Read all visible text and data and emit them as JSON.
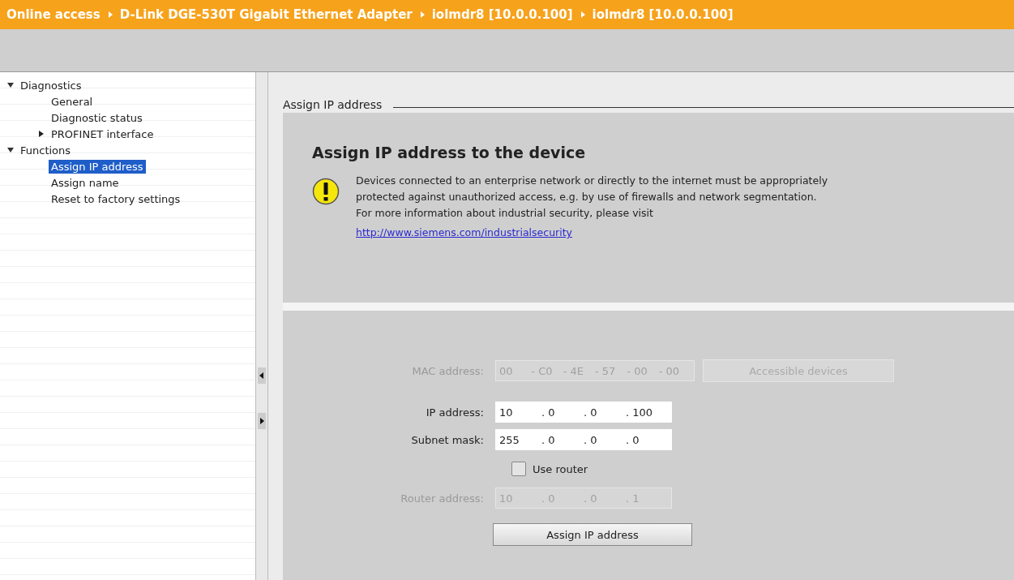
{
  "breadcrumb": [
    "Online access",
    "D-Link DGE-530T Gigabit Ethernet Adapter",
    "iolmdr8 [10.0.0.100]",
    "iolmdr8 [10.0.0.100]"
  ],
  "tree": [
    {
      "label": "Diagnostics",
      "expanded": true,
      "selected": false,
      "children": [
        {
          "label": "General",
          "selected": false
        },
        {
          "label": "Diagnostic status",
          "selected": false
        },
        {
          "label": "PROFINET interface",
          "expanded": false,
          "selected": false
        }
      ]
    },
    {
      "label": "Functions",
      "expanded": true,
      "selected": false,
      "children": [
        {
          "label": "Assign IP address",
          "selected": true
        },
        {
          "label": "Assign name",
          "selected": false
        },
        {
          "label": "Reset to factory settings",
          "selected": false
        }
      ]
    }
  ],
  "section_title": "Assign IP address",
  "notice": {
    "heading": "Assign IP address to the device",
    "lines": [
      "Devices connected to an enterprise network or directly to the internet must be appropriately",
      "protected against unauthorized access, e.g. by use of firewalls and network segmentation.",
      "For more information about industrial security, please visit"
    ],
    "link": "http://www.siemens.com/industrialsecurity"
  },
  "form": {
    "rows": [
      {
        "kind": "address",
        "label": "MAC address:",
        "disabled": true,
        "separator": "-",
        "parts": [
          "00",
          "C0",
          "4E",
          "57",
          "00",
          "00"
        ],
        "button": {
          "label": "Accessible devices",
          "disabled": true
        }
      },
      {
        "kind": "address",
        "label": "IP address:",
        "disabled": false,
        "separator": ".",
        "parts": [
          "10",
          "0",
          "0",
          "100"
        ]
      },
      {
        "kind": "address",
        "label": "Subnet mask:",
        "disabled": false,
        "separator": ".",
        "parts": [
          "255",
          "0",
          "0",
          "0"
        ]
      },
      {
        "kind": "checkbox",
        "label": "Use router",
        "checked": false
      },
      {
        "kind": "address",
        "label": "Router address:",
        "disabled": true,
        "separator": ".",
        "parts": [
          "10",
          "0",
          "0",
          "1"
        ]
      }
    ],
    "submit": "Assign IP address"
  }
}
